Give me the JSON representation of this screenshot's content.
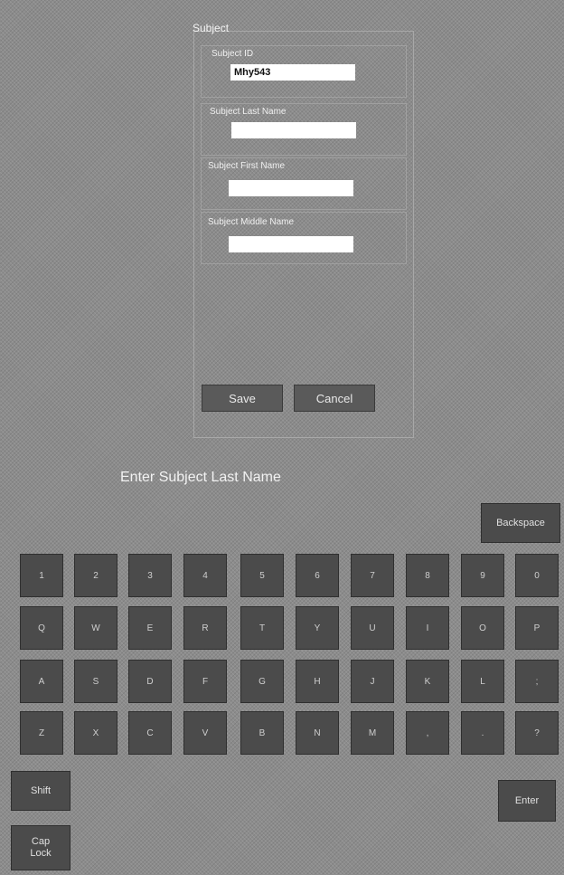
{
  "form": {
    "title": "Subject",
    "fields": [
      {
        "label": "Subject ID",
        "value": "Mhy543"
      },
      {
        "label": "Subject Last Name",
        "value": ""
      },
      {
        "label": "Subject First Name",
        "value": ""
      },
      {
        "label": "Subject Middle Name",
        "value": ""
      }
    ],
    "save_label": "Save",
    "cancel_label": "Cancel"
  },
  "keyboard": {
    "prompt": "Enter Subject Last Name",
    "backspace_label": "Backspace",
    "shift_label": "Shift",
    "enter_label": "Enter",
    "caps_lock_label_line1": "Cap",
    "caps_lock_label_line2": "Lock",
    "rows": [
      [
        "1",
        "2",
        "3",
        "4",
        "5",
        "6",
        "7",
        "8",
        "9",
        "0"
      ],
      [
        "Q",
        "W",
        "E",
        "R",
        "T",
        "Y",
        "U",
        "I",
        "O",
        "P"
      ],
      [
        "A",
        "S",
        "D",
        "F",
        "G",
        "H",
        "J",
        "K",
        "L",
        ";"
      ],
      [
        "Z",
        "X",
        "C",
        "V",
        "B",
        "N",
        "M",
        ",",
        ".",
        "?"
      ]
    ]
  }
}
